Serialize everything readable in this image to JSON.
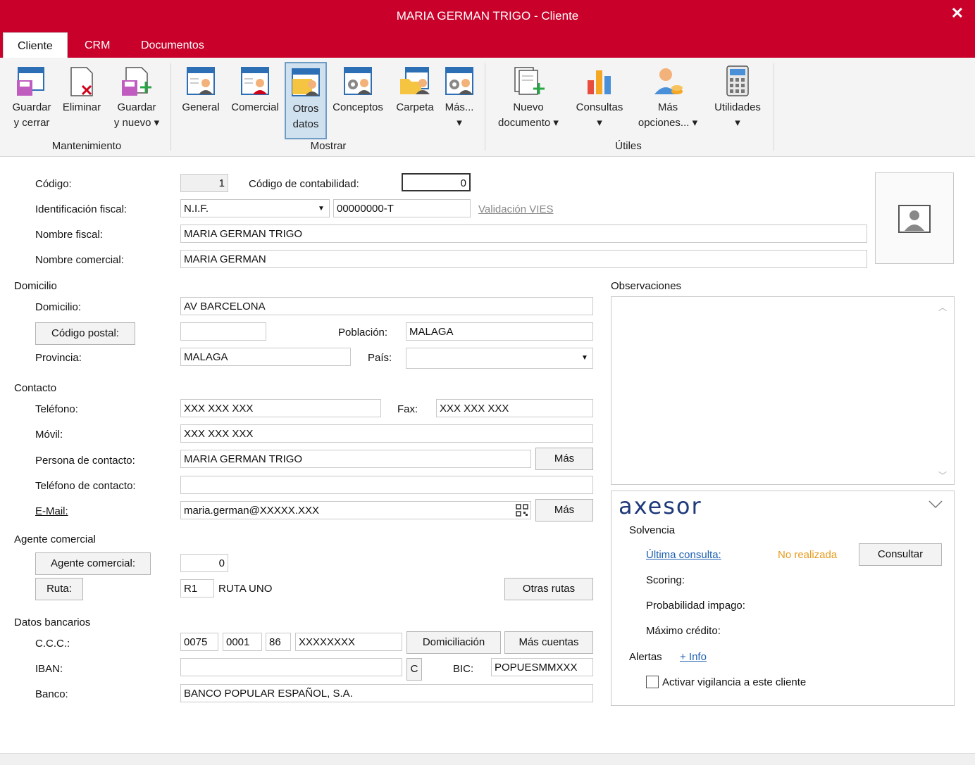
{
  "window": {
    "title": "MARIA GERMAN TRIGO - Cliente",
    "close": "✕"
  },
  "tabs": [
    "Cliente",
    "CRM",
    "Documentos"
  ],
  "ribbon": {
    "mantenimiento": {
      "label": "Mantenimiento",
      "guardar_cerrar": [
        "Guardar",
        "y cerrar"
      ],
      "eliminar": [
        "Eliminar",
        ""
      ],
      "guardar_nuevo": [
        "Guardar",
        "y nuevo ▾"
      ]
    },
    "mostrar": {
      "label": "Mostrar",
      "general": "General",
      "comercial": "Comercial",
      "otros_datos": [
        "Otros",
        "datos"
      ],
      "conceptos": "Conceptos",
      "carpeta": "Carpeta",
      "mas": [
        "Más...",
        "▾"
      ]
    },
    "utiles": {
      "label": "Útiles",
      "nuevo_documento": [
        "Nuevo",
        "documento ▾"
      ],
      "consultas": [
        "Consultas",
        "▾"
      ],
      "mas_opciones": [
        "Más",
        "opciones... ▾"
      ],
      "utilidades": [
        "Utilidades",
        "▾"
      ]
    }
  },
  "form": {
    "codigo_label": "Código:",
    "codigo": "1",
    "codigo_contabilidad_label": "Código de contabilidad:",
    "codigo_contabilidad": "0",
    "identificacion_label": "Identificación fiscal:",
    "tipo_id": "N.I.F.",
    "nif": "00000000-T",
    "validacion_vies": "Validación VIES",
    "nombre_fiscal_label": "Nombre fiscal:",
    "nombre_fiscal": "MARIA GERMAN TRIGO",
    "nombre_comercial_label": "Nombre comercial:",
    "nombre_comercial": "MARIA GERMAN",
    "domicilio_section": "Domicilio",
    "domicilio_label": "Domicilio:",
    "domicilio": "AV BARCELONA",
    "codigo_postal_btn": "Código postal:",
    "codigo_postal": "",
    "poblacion_label": "Población:",
    "poblacion": "MALAGA",
    "provincia_label": "Provincia:",
    "provincia": "MALAGA",
    "pais_label": "País:",
    "pais": "",
    "contacto_section": "Contacto",
    "telefono_label": "Teléfono:",
    "telefono": "XXX XXX XXX",
    "fax_label": "Fax:",
    "fax": "XXX XXX XXX",
    "movil_label": "Móvil:",
    "movil": "XXX XXX XXX",
    "persona_contacto_label": "Persona de contacto:",
    "persona_contacto": "MARIA GERMAN TRIGO",
    "mas_btn": "Más",
    "telefono_contacto_label": "Teléfono de contacto:",
    "telefono_contacto": "",
    "email_label": "E-Mail:",
    "email": "maria.german@XXXXX.XXX",
    "agente_section": "Agente comercial",
    "agente_btn": "Agente comercial:",
    "agente": "0",
    "ruta_btn": "Ruta:",
    "ruta_codigo": "R1",
    "ruta_nombre": "RUTA UNO",
    "otras_rutas_btn": "Otras rutas",
    "bancarios_section": "Datos bancarios",
    "ccc_label": "C.C.C.:",
    "ccc": [
      "0075",
      "0001",
      "86",
      "XXXXXXXX"
    ],
    "domiciliacion_btn": "Domiciliación",
    "mas_cuentas_btn": "Más cuentas",
    "iban_label": "IBAN:",
    "iban": "",
    "iban_c_btn": "C",
    "bic_label": "BIC:",
    "bic": "POPUESMMXXX",
    "banco_label": "Banco:",
    "banco": "BANCO POPULAR ESPAÑOL, S.A."
  },
  "observaciones": {
    "label": "Observaciones",
    "text": ""
  },
  "axesor": {
    "logo": "axesor",
    "solvencia": "Solvencia",
    "ultima_consulta": "Última consulta:",
    "estado": "No realizada",
    "consultar_btn": "Consultar",
    "scoring": "Scoring:",
    "probabilidad": "Probabilidad impago:",
    "maximo_credito": "Máximo crédito:",
    "alertas": "Alertas",
    "info": "+ Info",
    "vigilancia": "Activar vigilancia a este cliente"
  },
  "colors": {
    "accent": "#c8002a",
    "status_orange": "#e89b1c",
    "link": "#1c5fb0"
  },
  "icons": [
    "save-close-icon",
    "delete-icon",
    "save-new-icon",
    "general-icon",
    "comercial-icon",
    "otros-datos-icon",
    "conceptos-icon",
    "carpeta-icon",
    "mas-icon",
    "nuevo-documento-icon",
    "consultas-icon",
    "mas-opciones-icon",
    "utilidades-icon",
    "photo-placeholder-icon",
    "qr-icon",
    "chevron-down-icon"
  ]
}
